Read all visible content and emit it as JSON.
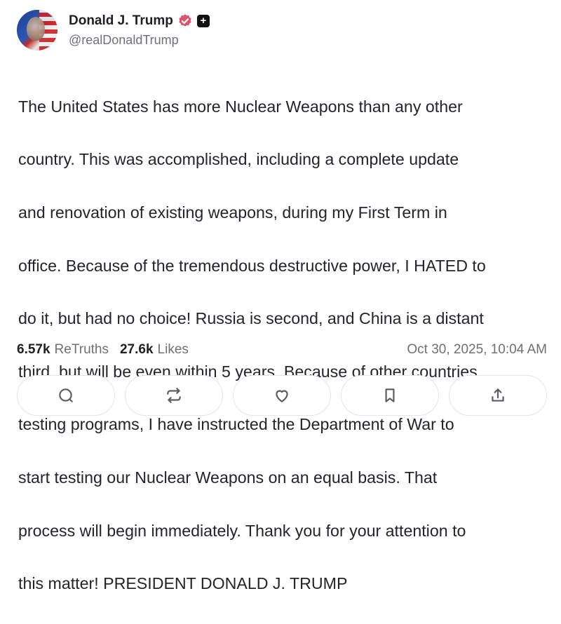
{
  "author": {
    "display_name": "Donald J. Trump",
    "handle": "@realDonaldTrump"
  },
  "post": {
    "lines": [
      "The United States has more Nuclear Weapons than any other",
      "country. This was accomplished, including a complete update",
      "and renovation of existing weapons, during my First Term in",
      "office. Because of the tremendous destructive power, I HATED to",
      "do it, but had no choice! Russia is second, and China is a distant",
      "third, but will be even within 5 years. Because of other countries",
      "testing programs, I have instructed the Department of War to",
      "start testing our Nuclear Weapons on an equal basis. That",
      "process will begin immediately. Thank you for your attention to",
      "this matter! PRESIDENT DONALD J. TRUMP"
    ]
  },
  "stats": {
    "retruths_count": "6.57k",
    "retruths_label": "ReTruths",
    "likes_count": "27.6k",
    "likes_label": "Likes",
    "timestamp": "Oct 30, 2025, 10:04 AM"
  },
  "actions": {
    "items": [
      "reply-icon",
      "retruth-icon",
      "like-icon",
      "bookmark-icon",
      "share-icon"
    ]
  },
  "colors": {
    "verified_badge": "#d9546e",
    "text": "#24242a",
    "muted": "#6f6f78",
    "border": "#e4e4ea"
  }
}
